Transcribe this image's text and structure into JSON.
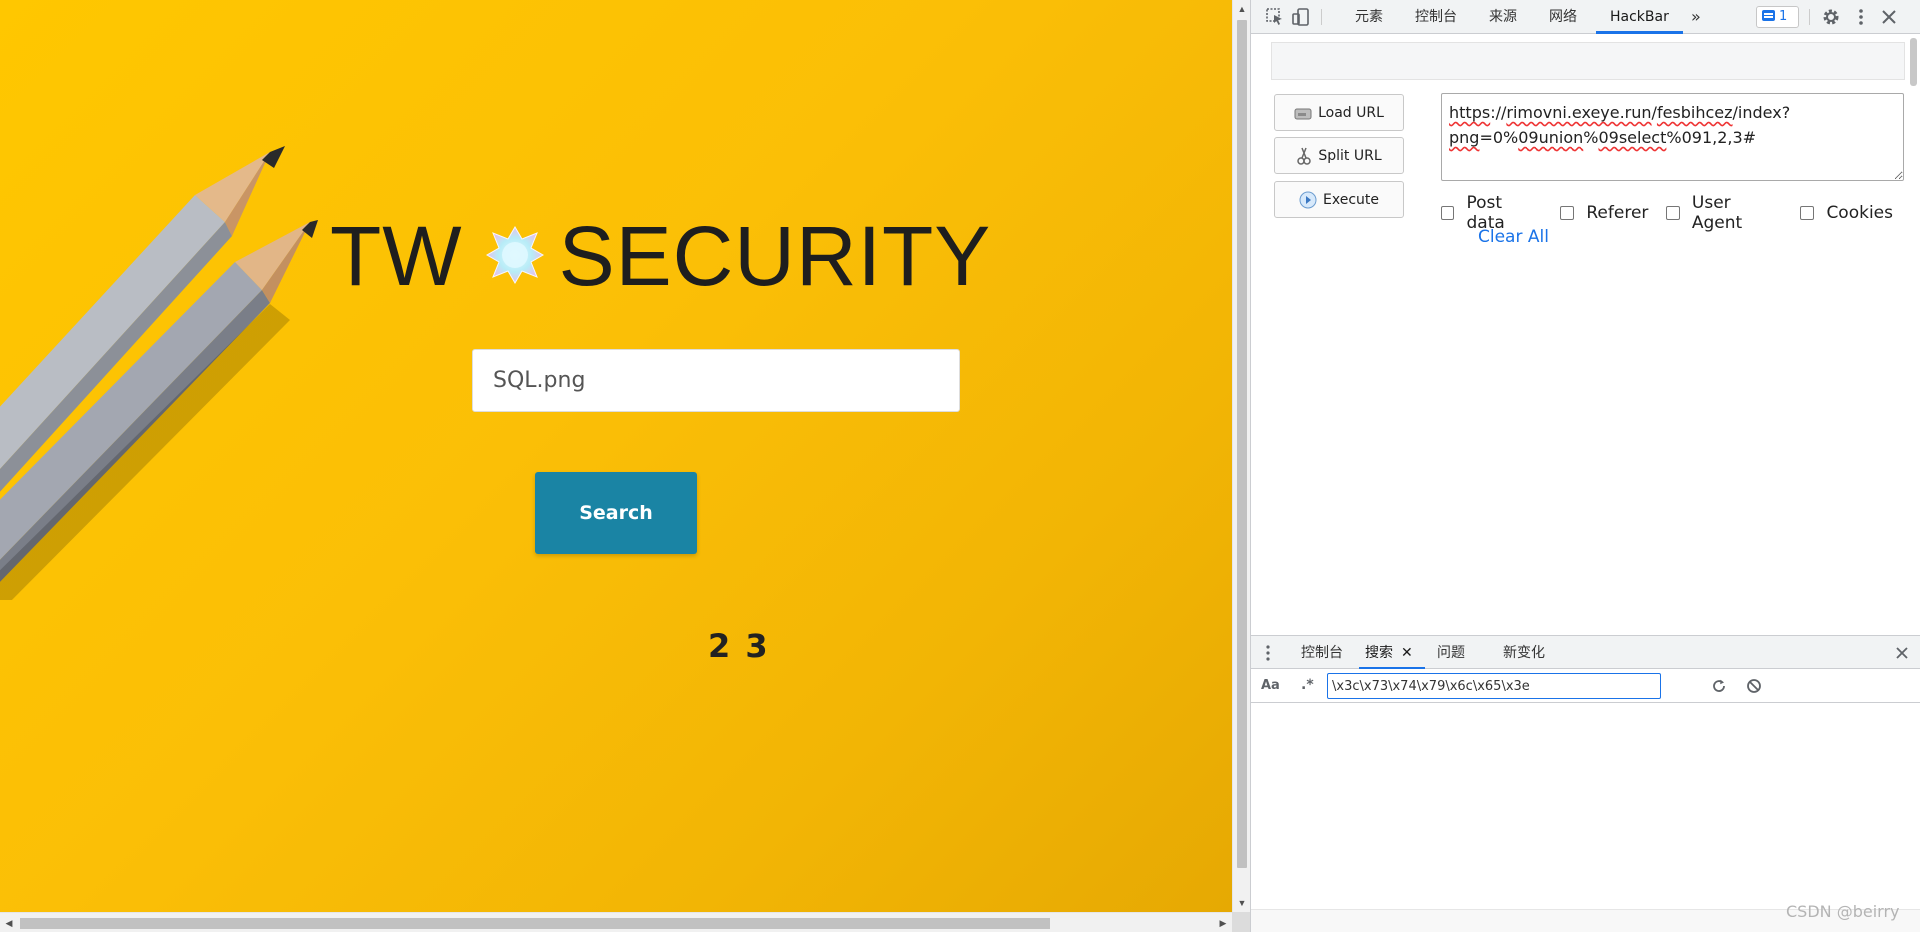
{
  "page": {
    "site_title_left": "TW",
    "site_title_right": "SECURITY",
    "search_value": "SQL.png",
    "search_button": "Search",
    "result_text": "2 3"
  },
  "devtools": {
    "tabs": [
      "元素",
      "控制台",
      "来源",
      "网络",
      "HackBar"
    ],
    "active_tab": "HackBar",
    "more_tabs": "»",
    "issues_count": "1"
  },
  "hackbar": {
    "buttons": {
      "load": "Load URL",
      "split": "Split URL",
      "execute": "Execute"
    },
    "url_parts": {
      "p1": "https",
      "p2": "://",
      "p3": "rimovni.exeye.run",
      "p4": "/",
      "p5": "fesbihcez",
      "p6": "/index?",
      "p7": "png",
      "p8": "=0%",
      "p9": "09union",
      "p10": "%",
      "p11": "09select",
      "p12": "%091,2,3#"
    },
    "options": [
      "Post data",
      "Referer",
      "User Agent",
      "Cookies"
    ],
    "clear_all": "Clear All"
  },
  "drawer": {
    "tabs": [
      "控制台",
      "搜索",
      "问题",
      "新变化"
    ],
    "active_tab": "搜索",
    "case_toggle": "Aa",
    "regex_toggle": ".*",
    "search_query": "\\x3c\\x73\\x74\\x79\\x6c\\x65\\x3e"
  },
  "watermark": "CSDN @beirry",
  "colors": {
    "page_bg": "#fbbf06",
    "search_button_bg": "#1a84a4",
    "devtools_accent": "#1a73e8"
  }
}
